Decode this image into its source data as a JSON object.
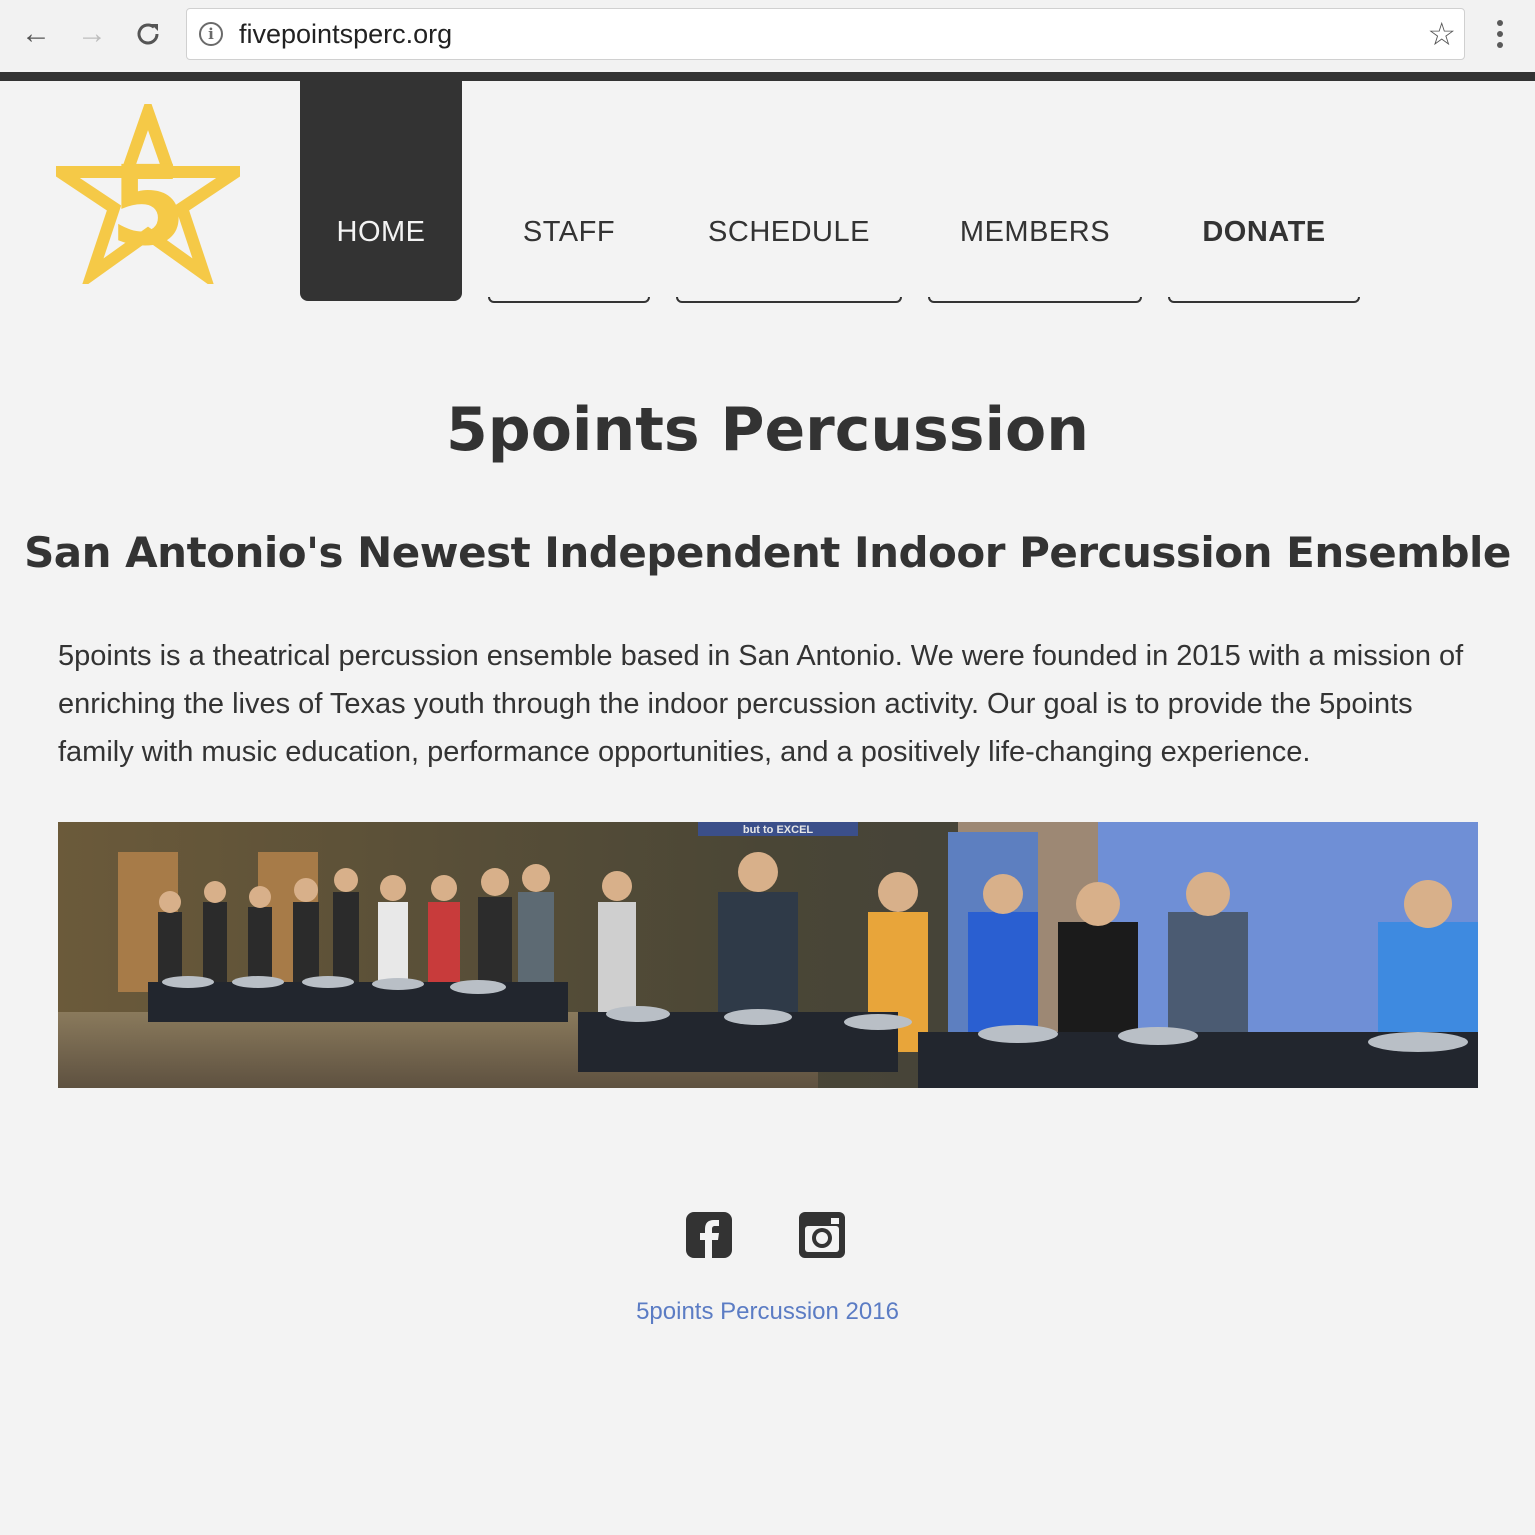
{
  "browser": {
    "url": "fivepointsperc.org",
    "back_icon": "arrow-left-icon",
    "forward_icon": "arrow-right-icon",
    "reload_icon": "reload-icon",
    "info_icon": "info-icon",
    "bookmark_icon": "star-icon",
    "menu_icon": "kebab-menu-icon"
  },
  "header": {
    "logo_icon": "star-five-logo",
    "logo_color": "#f5c947",
    "nav": [
      {
        "label": "HOME",
        "active": true
      },
      {
        "label": "STAFF",
        "active": false
      },
      {
        "label": "SCHEDULE",
        "active": false
      },
      {
        "label": "MEMBERS",
        "active": false
      },
      {
        "label": "DONATE",
        "active": false
      }
    ]
  },
  "main": {
    "title": "5points Percussion",
    "subtitle": "San Antonio's Newest Independent Indoor Percussion Ensemble",
    "intro": "5points is a theatrical percussion ensemble based in San Antonio.  We were founded in 2015 with a mission of enriching the lives of Texas youth through the indoor percussion activity.  Our goal is to provide the 5points family with music education, performance opportunities, and a positively life-changing experience.",
    "photo_banner_text": "but to EXCEL"
  },
  "footer": {
    "social": [
      {
        "icon": "facebook-icon"
      },
      {
        "icon": "instagram-icon"
      }
    ],
    "copyright": "5points Percussion 2016",
    "link_color": "#5b7cc4"
  },
  "colors": {
    "background": "#f3f3f3",
    "dark": "#333333",
    "accent": "#f5c947"
  }
}
